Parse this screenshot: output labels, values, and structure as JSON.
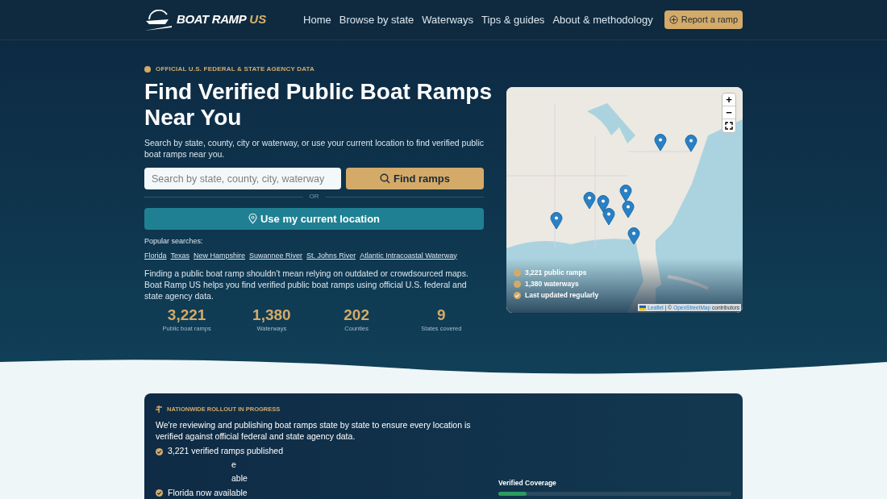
{
  "header": {
    "logo": {
      "main": "BOAT RAMP",
      "accent": "US"
    },
    "nav": [
      "Home",
      "Browse by state",
      "Waterways",
      "Tips & guides",
      "About & methodology"
    ],
    "cta": "Report a ramp"
  },
  "hero": {
    "eyebrow": "OFFICIAL U.S. FEDERAL & STATE AGENCY DATA",
    "title": "Find Verified Public Boat Ramps Near You",
    "subtitle": "Search by state, county, city or waterway, or use your current location to find verified public boat ramps near you.",
    "search": {
      "placeholder": "Search by state, county, city, waterway",
      "button": "Find ramps"
    },
    "divider": "OR",
    "location_button": "Use my current location",
    "popular": {
      "label": "Popular searches:",
      "links": [
        "Florida",
        "Texas",
        "New Hampshire",
        "Suwannee River",
        "St. Johns River",
        "Atlantic Intracoastal Waterway"
      ]
    },
    "intro": "Finding a public boat ramp shouldn't mean relying on outdated or crowdsourced maps. Boat Ramp US helps you find verified public boat ramps using official U.S. federal and state agency data.",
    "stats": [
      {
        "value": "3,221",
        "label": "Public boat ramps"
      },
      {
        "value": "1,380",
        "label": "Waterways"
      },
      {
        "value": "202",
        "label": "Counties"
      },
      {
        "value": "9",
        "label": "States covered"
      }
    ]
  },
  "map": {
    "kind": "picture",
    "controls": [
      "+",
      "−"
    ],
    "legend": [
      {
        "kind": "dot",
        "text": "3,221 public ramps"
      },
      {
        "kind": "dot",
        "text": "1,380 waterways"
      },
      {
        "kind": "check",
        "text": "Last updated regularly"
      }
    ],
    "attribution": [
      {
        "text": "Leaflet",
        "link": true
      },
      {
        "text": "| ©",
        "link": false
      },
      {
        "text": "OpenStreetMap",
        "link": true
      },
      {
        "text": "contributors",
        "link": false
      }
    ]
  },
  "rollout": {
    "badge": "NATIONWIDE ROLLOUT IN PROGRESS",
    "text": "We're reviewing and publishing boat ramps state by state to ensure every location is verified against official federal and state agency data.",
    "items": [
      {
        "kind": "full",
        "text": "3,221 verified ramps published"
      },
      {
        "kind": "partial",
        "text": "e"
      },
      {
        "kind": "partial",
        "text": "able"
      },
      {
        "kind": "full",
        "text": "Florida now available"
      }
    ],
    "coverage": {
      "label": "Verified Coverage",
      "level": 0.12
    }
  }
}
